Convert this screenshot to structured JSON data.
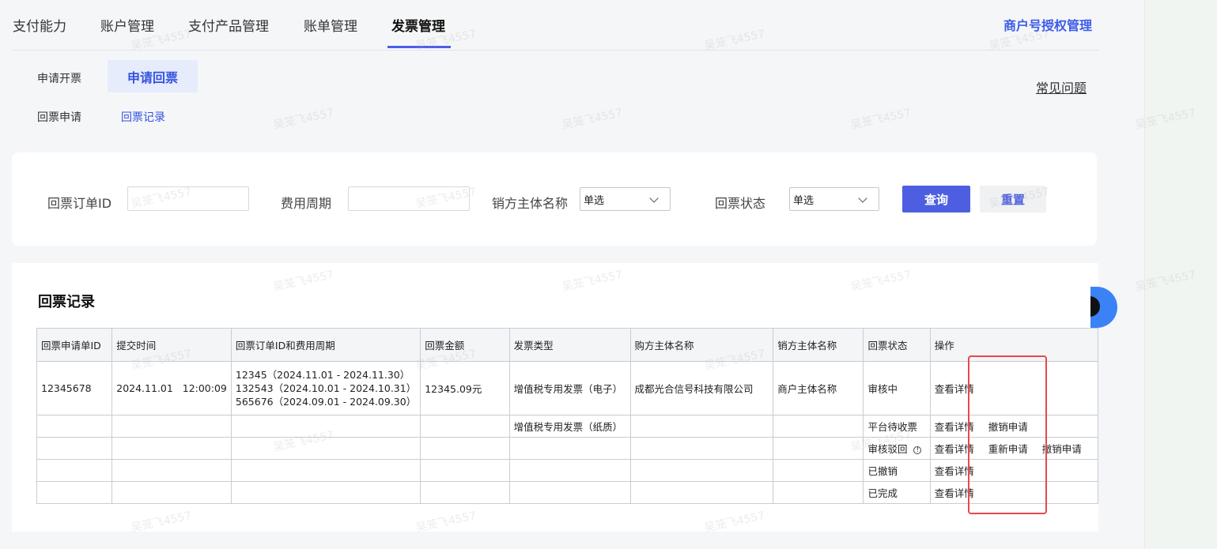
{
  "top_nav": {
    "tabs": [
      "支付能力",
      "账户管理",
      "支付产品管理",
      "账单管理",
      "发票管理"
    ],
    "active_tab": "发票管理",
    "auth_link": "商户号授权管理"
  },
  "sub_nav": {
    "primary": [
      "申请开票",
      "申请回票"
    ],
    "secondary": [
      "回票申请",
      "回票记录"
    ],
    "faq_link": "常见问题"
  },
  "filters": {
    "order_id_label": "回票订单ID",
    "period_label": "费用周期",
    "seller_label": "销方主体名称",
    "seller_value": "单选",
    "status_label": "回票状态",
    "status_value": "单选",
    "query_button": "查询",
    "reset_button": "重置"
  },
  "records": {
    "title": "回票记录",
    "columns": [
      "回票申请单ID",
      "提交时间",
      "回票订单ID和费用周期",
      "回票金额",
      "发票类型",
      "购方主体名称",
      "销方主体名称",
      "回票状态",
      "操作"
    ],
    "row1": {
      "id": "12345678",
      "time": "2024.11.01   12:00:09",
      "orders": [
        "12345（2024.11.01 - 2024.11.30）",
        "132543（2024.10.01 - 2024.10.31）",
        "565676（2024.09.01 - 2024.09.30）"
      ],
      "amount": "12345.09元",
      "invoice_type": "增值税专用发票（电子）",
      "buyer": "成都光合信号科技有限公司",
      "seller": "商户主体名称",
      "status": "审核中",
      "ops": [
        "查看详情"
      ]
    },
    "row2": {
      "invoice_type": "增值税专用发票（纸质）",
      "status": "平台待收票",
      "ops": [
        "查看详情",
        "撤销申请"
      ]
    },
    "row3": {
      "status": "审核驳回",
      "ops": [
        "查看详情",
        "重新申请",
        "撤销申请"
      ]
    },
    "row4": {
      "status": "已撤销",
      "ops": [
        "查看详情"
      ]
    },
    "row5": {
      "status": "已完成",
      "ops": [
        "查看详情"
      ]
    }
  },
  "watermark_text": "吴笼飞4557",
  "colors": {
    "accent": "#4d5fe0",
    "link": "#3352e0",
    "highlight": "#e5484d"
  }
}
